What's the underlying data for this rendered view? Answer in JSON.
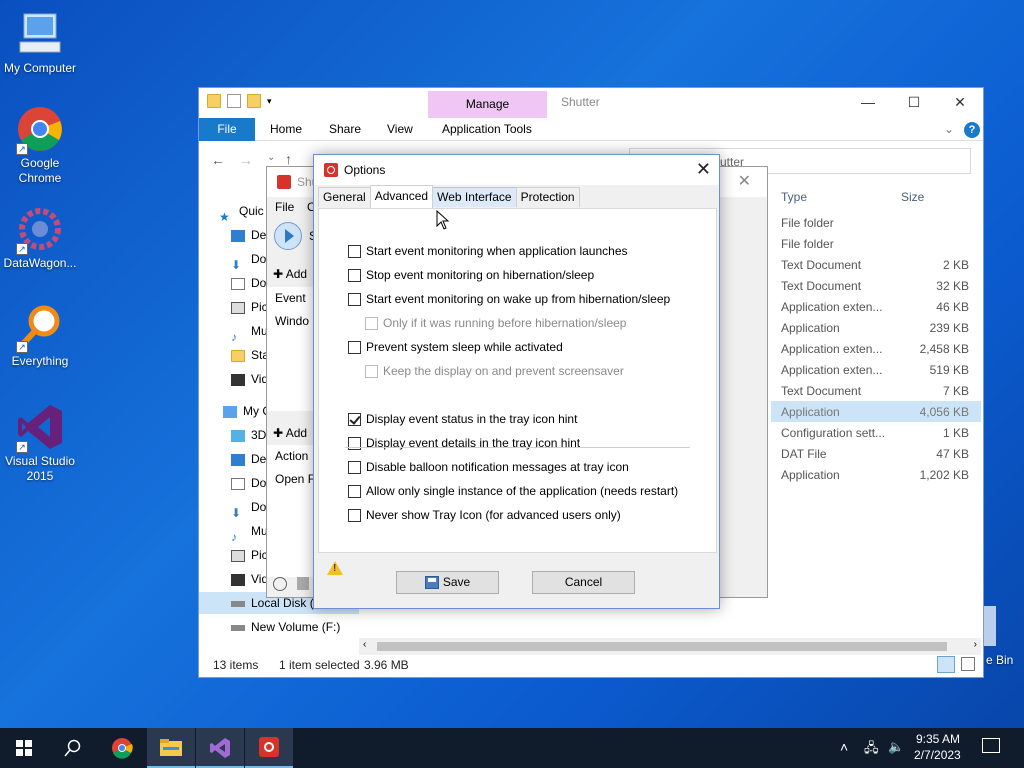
{
  "desktop": {
    "icons": [
      {
        "label": "My Computer"
      },
      {
        "label": "Google Chrome"
      },
      {
        "label": "DataWagon..."
      },
      {
        "label": "Everything"
      },
      {
        "label": "Visual Studio 2015"
      },
      {
        "label": "Recycle Bin (partial)",
        "visible_text": "e Bin"
      }
    ]
  },
  "explorer": {
    "title": "Shutter",
    "contextual_tab": "Manage",
    "ribbon_tabs": [
      "File",
      "Home",
      "Share",
      "View",
      "Application Tools"
    ],
    "address_partial": "utter",
    "nav_items": [
      "Quic",
      "De",
      "Do",
      "Do",
      "Pic",
      "Mu",
      "Sta",
      "Vid",
      "My C",
      "3D",
      "De",
      "Do",
      "Do",
      "Mu",
      "Pic",
      "Vid",
      "Local Disk (",
      "New Volume (F:)"
    ],
    "columns": {
      "type": "Type",
      "size": "Size"
    },
    "rows": [
      {
        "type": "File folder",
        "size": ""
      },
      {
        "type": "File folder",
        "size": ""
      },
      {
        "type": "Text Document",
        "size": "2 KB"
      },
      {
        "type": "Text Document",
        "size": "32 KB"
      },
      {
        "type": "Application exten...",
        "size": "46 KB"
      },
      {
        "type": "Application",
        "size": "239 KB"
      },
      {
        "type": "Application exten...",
        "size": "2,458 KB"
      },
      {
        "type": "Application exten...",
        "size": "519 KB"
      },
      {
        "type": "Text Document",
        "size": "7 KB"
      },
      {
        "type": "Application",
        "size": "4,056 KB",
        "selected": true
      },
      {
        "type": "Configuration sett...",
        "size": "1 KB"
      },
      {
        "type": "DAT File",
        "size": "47 KB"
      },
      {
        "type": "Application",
        "size": "1,202 KB"
      }
    ],
    "status": {
      "items": "13 items",
      "selected": "1 item selected",
      "size": "3.96 MB"
    }
  },
  "shutter_app": {
    "title_partial": "Shu",
    "menu": [
      "File",
      "O"
    ],
    "start_partial": "S",
    "add_event": "Add",
    "events_header": "Event",
    "event_row": "Windo",
    "add_action": "Add",
    "actions_header": "Action",
    "action_row": "Open F"
  },
  "dialog": {
    "title": "Options",
    "tabs": [
      "General",
      "Advanced",
      "Web Interface",
      "Protection"
    ],
    "active_tab": "Advanced",
    "options": [
      {
        "label": "Start event monitoring when application launches",
        "checked": false,
        "enabled": true
      },
      {
        "label": "Stop event monitoring on hibernation/sleep",
        "checked": false,
        "enabled": true
      },
      {
        "label": "Start event monitoring on wake up from hibernation/sleep",
        "checked": false,
        "enabled": true
      },
      {
        "label": "Only if it was running before hibernation/sleep",
        "checked": false,
        "enabled": false
      },
      {
        "label": "Prevent system sleep while activated",
        "checked": false,
        "enabled": true
      },
      {
        "label": "Keep the display on and prevent screensaver",
        "checked": false,
        "enabled": false
      },
      {
        "label": "Display event status in the tray icon hint",
        "checked": true,
        "enabled": true
      },
      {
        "label": "Display event details in the tray icon hint",
        "checked": false,
        "enabled": true
      },
      {
        "label": "Disable balloon notification messages at tray icon",
        "checked": false,
        "enabled": true
      },
      {
        "label": "Allow only single instance of the application (needs restart)",
        "checked": false,
        "enabled": true
      },
      {
        "label": "Never show Tray Icon (for advanced users only)",
        "checked": false,
        "enabled": true
      }
    ],
    "save_label": "Save",
    "cancel_label": "Cancel"
  },
  "taskbar": {
    "time": "9:35 AM",
    "date": "2/7/2023"
  },
  "colors": {
    "accent": "#1979ca",
    "manage_tab": "#f0c6f5",
    "selection": "#cce4f7",
    "taskbar": "#101b2b"
  }
}
